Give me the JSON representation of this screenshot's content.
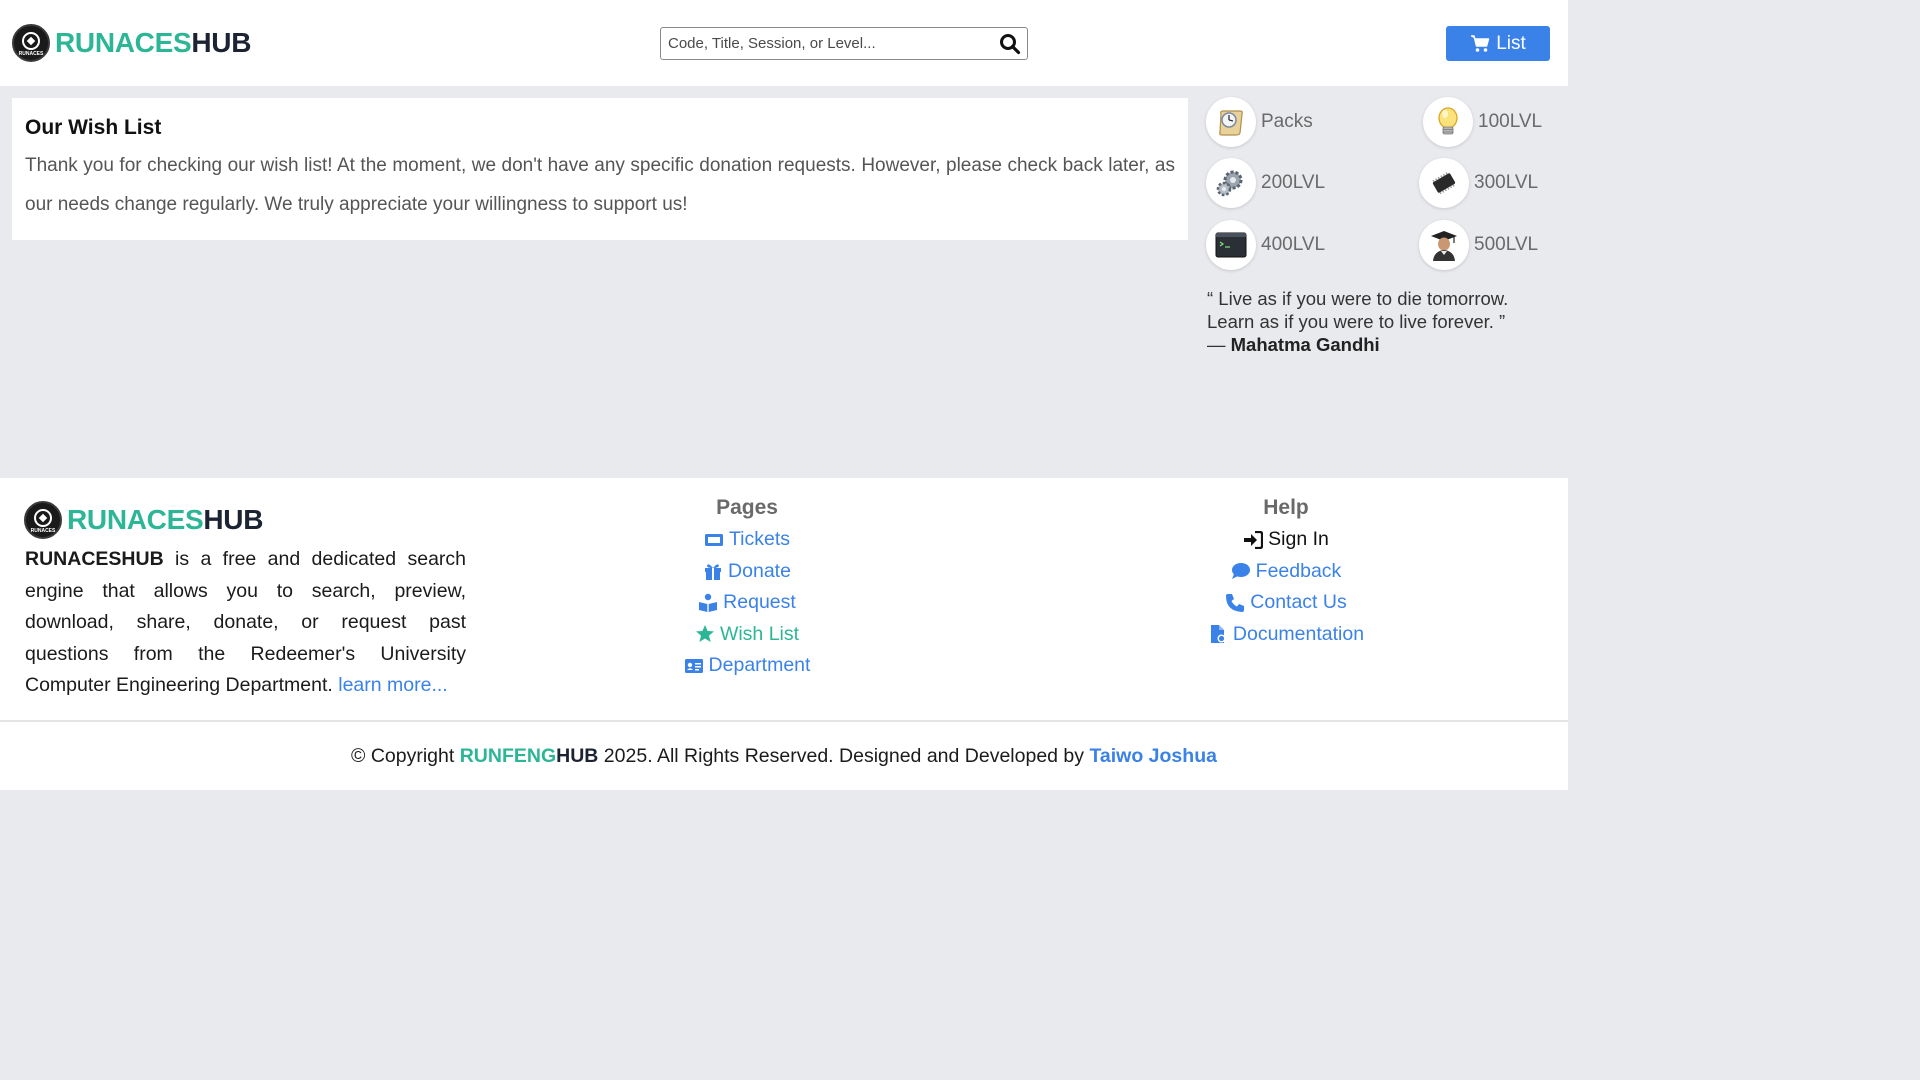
{
  "header": {
    "brand_part1": "RUNACES",
    "brand_part2": "HUB",
    "logo_text": "RUNACES",
    "search_placeholder": "Code, Title, Session, or Level...",
    "list_label": "List"
  },
  "main": {
    "title": "Our Wish List",
    "body": "Thank you for checking our wish list! At the moment, we don't have any specific donation requests. However, please check back later, as our needs change regularly. We truly appreciate your willingness to support us!"
  },
  "levels": [
    {
      "label": "Packs",
      "icon": "scroll-clock-icon"
    },
    {
      "label": "100LVL",
      "icon": "lightbulb-icon"
    },
    {
      "label": "200LVL",
      "icon": "gears-icon"
    },
    {
      "label": "300LVL",
      "icon": "chip-icon"
    },
    {
      "label": "400LVL",
      "icon": "terminal-icon"
    },
    {
      "label": "500LVL",
      "icon": "graduate-icon"
    }
  ],
  "quote": {
    "text": "“ Live as if you were to die tomorrow. Learn as if you were to live forever. ”",
    "dash": "—",
    "author": "Mahatma Gandhi"
  },
  "footer": {
    "brand_part1": "RUNACES",
    "brand_part2": "HUB",
    "desc_bold": "RUNACESHUB",
    "desc_text": " is a free and dedicated search engine that allows you to search, preview, download, share, donate, or request past questions from the Redeemer's University Computer Engineering Department. ",
    "desc_link": "learn more...",
    "pages_title": "Pages",
    "pages": [
      {
        "label": "Tickets",
        "icon": "ticket-icon"
      },
      {
        "label": "Donate",
        "icon": "gift-icon"
      },
      {
        "label": "Request",
        "icon": "book-reader-icon"
      },
      {
        "label": "Wish List",
        "icon": "star-icon"
      },
      {
        "label": "Department",
        "icon": "id-card-icon"
      }
    ],
    "help_title": "Help",
    "help": [
      {
        "label": "Sign In",
        "icon": "sign-in-icon"
      },
      {
        "label": "Feedback",
        "icon": "comment-icon"
      },
      {
        "label": "Contact Us",
        "icon": "phone-icon"
      },
      {
        "label": "Documentation",
        "icon": "file-icon"
      }
    ]
  },
  "copyright": {
    "prefix": "© Copyright ",
    "brand1": "RUNFENG",
    "brand2": "HUB",
    "middle": " 2025. All Rights Reserved. Designed and Developed by ",
    "author": "Taiwo Joshua"
  },
  "colors": {
    "accent_blue": "#3b82e8",
    "brand_green": "#2cb696",
    "brand_dark": "#1c2333",
    "background": "#e9eaee"
  }
}
